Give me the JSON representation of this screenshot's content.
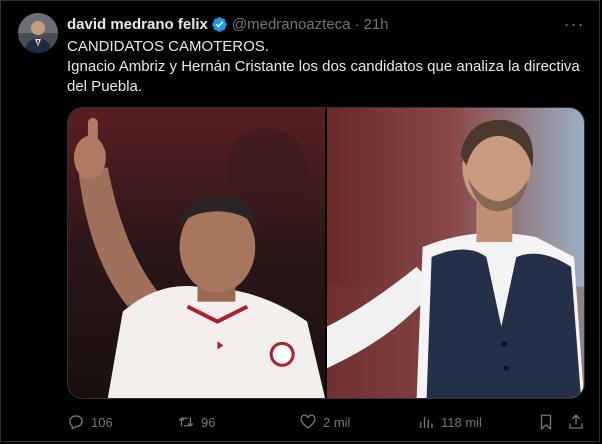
{
  "tweet": {
    "author_name": "david medrano felix",
    "handle": "@medranoazteca",
    "separator": "·",
    "time": "21h",
    "more_label": "···",
    "text_line1": "CANDIDATOS CAMOTEROS.",
    "text_line2": "Ignacio Ambriz y Hernán Cristante los dos candidatos que analiza la directiva del Puebla."
  },
  "actions": {
    "replies": "106",
    "retweets": "96",
    "likes": "2 mil",
    "views": "118 mil"
  },
  "colors": {
    "background": "#000000",
    "text": "#e7e9ea",
    "muted": "#71767b",
    "verified": "#1d9bf0",
    "border": "#2f3336"
  },
  "icons": [
    "verified-badge-icon",
    "more-icon",
    "reply-icon",
    "retweet-icon",
    "like-icon",
    "views-icon",
    "bookmark-icon",
    "share-icon"
  ]
}
